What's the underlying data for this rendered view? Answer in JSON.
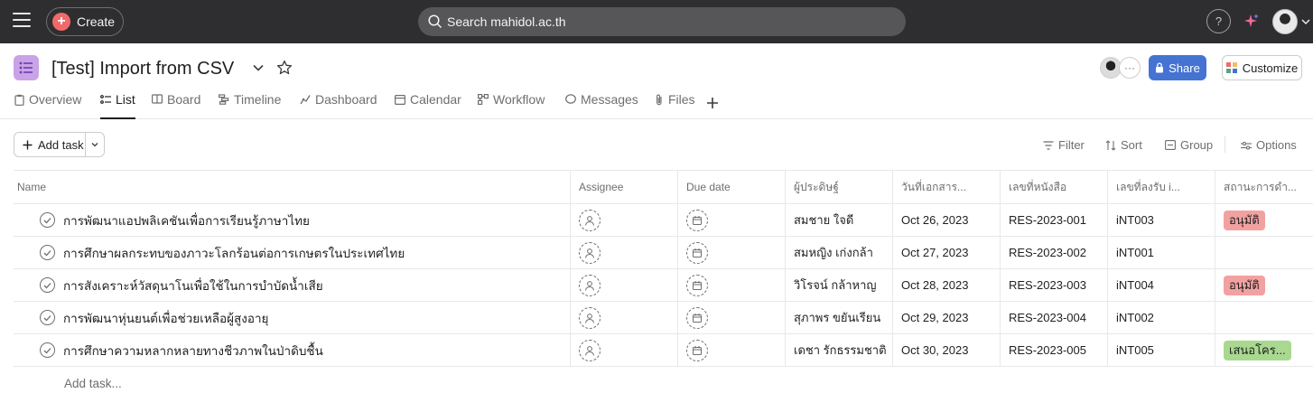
{
  "topbar": {
    "create_label": "Create",
    "search_placeholder": "Search mahidol.ac.th",
    "help_label": "?"
  },
  "project": {
    "title": "[Test] Import from CSV",
    "share_label": "Share",
    "customize_label": "Customize",
    "member_more": "···"
  },
  "tabs": [
    {
      "label": "Overview",
      "icon": "clipboard-icon"
    },
    {
      "label": "List",
      "icon": "list-icon"
    },
    {
      "label": "Board",
      "icon": "board-icon"
    },
    {
      "label": "Timeline",
      "icon": "timeline-icon"
    },
    {
      "label": "Dashboard",
      "icon": "dashboard-icon"
    },
    {
      "label": "Calendar",
      "icon": "calendar-icon"
    },
    {
      "label": "Workflow",
      "icon": "workflow-icon"
    },
    {
      "label": "Messages",
      "icon": "messages-icon"
    },
    {
      "label": "Files",
      "icon": "paperclip-icon"
    }
  ],
  "active_tab": "List",
  "toolbar": {
    "add_task": "Add task",
    "filter": "Filter",
    "sort": "Sort",
    "group": "Group",
    "options": "Options"
  },
  "table": {
    "columns": [
      "Name",
      "Assignee",
      "Due date",
      "ผู้ประดิษฐ์",
      "วันที่เอกสาร...",
      "เลขที่หนังสือ",
      "เลขที่ลงรับ i...",
      "สถานะการดำ..."
    ],
    "rows": [
      {
        "name": "การพัฒนาแอปพลิเคชันเพื่อการเรียนรู้ภาษาไทย",
        "inventor": "สมชาย ใจดี",
        "doc_date": "Oct 26, 2023",
        "book_no": "RES-2023-001",
        "recv_no": "iNT003",
        "status": "อนุมัติ",
        "status_color": "#f2a1a1"
      },
      {
        "name": "การศึกษาผลกระทบของภาวะโลกร้อนต่อการเกษตรในประเทศไทย",
        "inventor": "สมหญิง เก่งกล้า",
        "doc_date": "Oct 27, 2023",
        "book_no": "RES-2023-002",
        "recv_no": "iNT001",
        "status": "",
        "status_color": ""
      },
      {
        "name": "การสังเคราะห์วัสดุนาโนเพื่อใช้ในการบำบัดน้ำเสีย",
        "inventor": "วิโรจน์ กล้าหาญ",
        "doc_date": "Oct 28, 2023",
        "book_no": "RES-2023-003",
        "recv_no": "iNT004",
        "status": "อนุมัติ",
        "status_color": "#f2a1a1"
      },
      {
        "name": "การพัฒนาหุ่นยนต์เพื่อช่วยเหลือผู้สูงอายุ",
        "inventor": "สุภาพร ขยันเรียน",
        "doc_date": "Oct 29, 2023",
        "book_no": "RES-2023-004",
        "recv_no": "iNT002",
        "status": "",
        "status_color": ""
      },
      {
        "name": "การศึกษาความหลากหลายทางชีวภาพในป่าดิบชื้น",
        "inventor": "เดชา รักธรรมชาติ",
        "doc_date": "Oct 30, 2023",
        "book_no": "RES-2023-005",
        "recv_no": "iNT005",
        "status": "เสนอโคร...",
        "status_color": "#a8d98f"
      }
    ],
    "add_task_row": "Add task..."
  }
}
